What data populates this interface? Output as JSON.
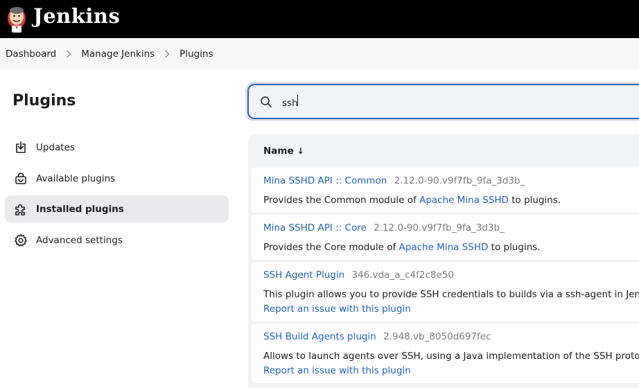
{
  "header": {
    "app_name": "Jenkins"
  },
  "breadcrumbs": [
    "Dashboard",
    "Manage Jenkins",
    "Plugins"
  ],
  "sidebar": {
    "title": "Plugins",
    "items": [
      {
        "label": "Updates",
        "icon": "download-icon",
        "active": false
      },
      {
        "label": "Available plugins",
        "icon": "shopping-bag-icon",
        "active": false
      },
      {
        "label": "Installed plugins",
        "icon": "puzzle-icon",
        "active": true
      },
      {
        "label": "Advanced settings",
        "icon": "gear-icon",
        "active": false
      }
    ]
  },
  "search": {
    "value": "ssh",
    "placeholder": ""
  },
  "table": {
    "header": "Name",
    "sort_indicator": "↓",
    "rows": [
      {
        "name": "Mina SSHD API :: Common",
        "version": "2.12.0-90.v9f7fb_9fa_3d3b_",
        "desc_prefix": "Provides the Common module of ",
        "desc_link": "Apache Mina SSHD",
        "desc_suffix": " to plugins.",
        "report": ""
      },
      {
        "name": "Mina SSHD API :: Core",
        "version": "2.12.0-90.v9f7fb_9fa_3d3b_",
        "desc_prefix": "Provides the Core module of ",
        "desc_link": "Apache Mina SSHD",
        "desc_suffix": " to plugins.",
        "report": ""
      },
      {
        "name": "SSH Agent Plugin",
        "version": "346.vda_a_c4f2c8e50",
        "desc_prefix": "This plugin allows you to provide SSH credentials to builds via a ssh-agent in Jenkins.",
        "desc_link": "",
        "desc_suffix": "",
        "report": "Report an issue with this plugin"
      },
      {
        "name": "SSH Build Agents plugin",
        "version": "2.948.vb_8050d697fec",
        "desc_prefix": "Allows to launch agents over SSH, using a Java implementation of the SSH protocol.",
        "desc_link": "",
        "desc_suffix": "",
        "report": "Report an issue with this plugin"
      }
    ]
  },
  "colors": {
    "accent": "#1f63b6",
    "topbar": "#000000",
    "active_item": "#eaeaed"
  }
}
